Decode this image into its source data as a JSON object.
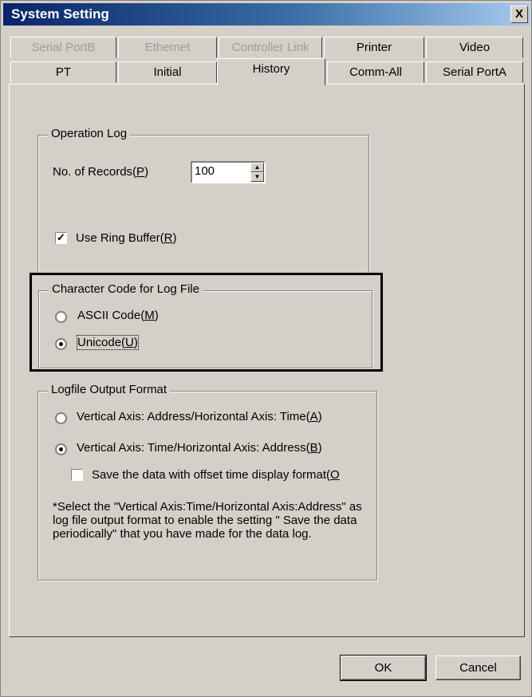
{
  "window": {
    "title": "System Setting",
    "close_label": "X"
  },
  "tabs": {
    "row1": [
      {
        "label": "Serial PortB",
        "disabled": true
      },
      {
        "label": "Ethernet",
        "disabled": true
      },
      {
        "label": "Controller Link",
        "disabled": true
      },
      {
        "label": "Printer",
        "disabled": false
      },
      {
        "label": "Video",
        "disabled": false
      }
    ],
    "row2": [
      {
        "label": "PT"
      },
      {
        "label": "Initial"
      },
      {
        "label": "History",
        "active": true
      },
      {
        "label": "Comm-All"
      },
      {
        "label": "Serial PortA"
      }
    ]
  },
  "operation_log": {
    "legend": "Operation Log",
    "records_label": "No. of Records(",
    "records_key": "P",
    "records_value": "100",
    "ring_buffer_label": "Use Ring Buffer(",
    "ring_buffer_key": "R",
    "ring_buffer_checked": true
  },
  "character_code": {
    "legend": "Character Code for Log File",
    "ascii_label": "ASCII Code(",
    "ascii_key": "M",
    "unicode_label": "Unicode(",
    "unicode_key": "U",
    "selected": "unicode"
  },
  "output_format": {
    "legend": "Logfile Output Format",
    "option_a_label": "Vertical Axis: Address/Horizontal Axis: Time(",
    "option_a_key": "A",
    "option_b_label": "Vertical Axis: Time/Horizontal Axis: Address(",
    "option_b_key": "B",
    "selected": "B",
    "offset_label": "Save the data with offset time display format(",
    "offset_key": "O",
    "offset_checked": false,
    "note": "*Select the \"Vertical Axis:Time/Horizontal Axis:Address\" as log file output format to enable the setting \" Save the data periodically\" that you have made for the data log."
  },
  "buttons": {
    "ok": "OK",
    "cancel": "Cancel"
  }
}
